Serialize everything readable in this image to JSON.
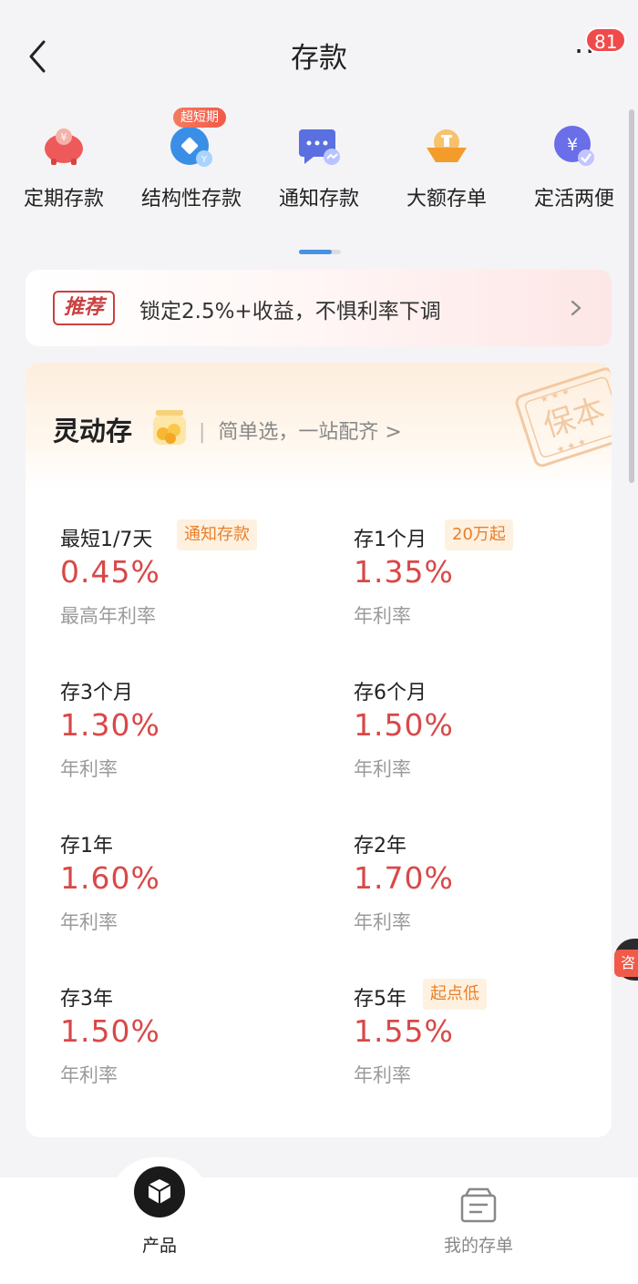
{
  "header": {
    "title": "存款",
    "notification_count": "81"
  },
  "quick_entries": [
    {
      "label": "定期存款",
      "icon": "piggy-bank-icon",
      "color": "#e84a4a"
    },
    {
      "label": "结构性存款",
      "icon": "structured-deposit-icon",
      "color": "#3a8ee6",
      "tag": "超短期"
    },
    {
      "label": "通知存款",
      "icon": "chat-notice-icon",
      "color": "#5a6fe0"
    },
    {
      "label": "大额存单",
      "icon": "large-certificate-icon",
      "color": "#f39c2b"
    },
    {
      "label": "定活两便",
      "icon": "yuan-coin-icon",
      "color": "#6a6ee8"
    }
  ],
  "recommend": {
    "tag": "推荐",
    "text": "锁定2.5%+收益，不惧利率下调"
  },
  "product_card": {
    "title": "灵动存",
    "subtitle": "简单选，一站配齐 >",
    "stamp": "保本",
    "items": [
      {
        "label": "最短1/7天",
        "tag": "通知存款",
        "rate": "0.45%",
        "note": "最高年利率"
      },
      {
        "label": "存1个月",
        "tag": "20万起",
        "rate": "1.35%",
        "note": "年利率"
      },
      {
        "label": "存3个月",
        "tag": "",
        "rate": "1.30%",
        "note": "年利率"
      },
      {
        "label": "存6个月",
        "tag": "",
        "rate": "1.50%",
        "note": "年利率"
      },
      {
        "label": "存1年",
        "tag": "",
        "rate": "1.60%",
        "note": "年利率"
      },
      {
        "label": "存2年",
        "tag": "",
        "rate": "1.70%",
        "note": "年利率"
      },
      {
        "label": "存3年",
        "tag": "",
        "rate": "1.50%",
        "note": "年利率"
      },
      {
        "label": "存5年",
        "tag": "起点低",
        "rate": "1.55%",
        "note": "年利率"
      }
    ]
  },
  "side_float": {
    "label": "咨"
  },
  "tabbar": {
    "products_label": "产品",
    "my_deposits_label": "我的存单"
  },
  "colors": {
    "accent_red": "#d94848",
    "tag_orange": "#e8802b",
    "pager_blue": "#4a90e2"
  }
}
